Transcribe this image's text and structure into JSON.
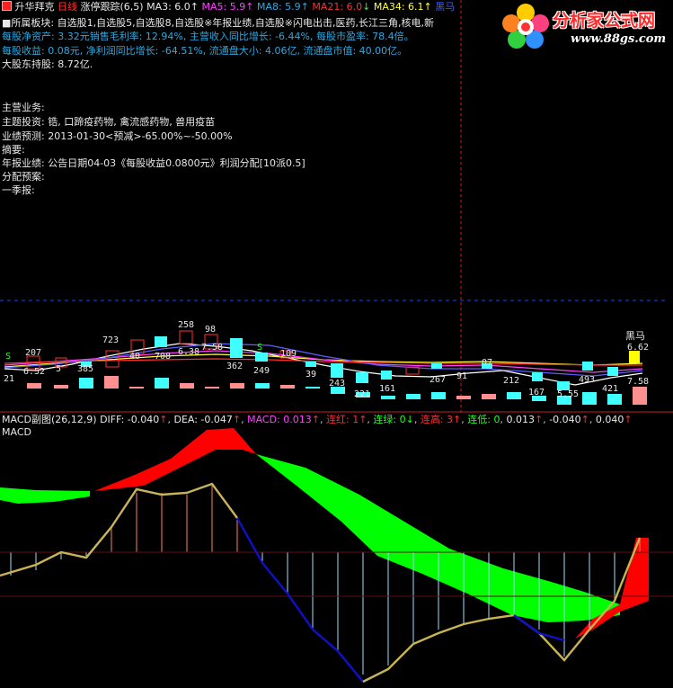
{
  "header": {
    "app_icon": "close-square-icon",
    "app_name": "升华拜克",
    "period": "日线",
    "indicator_name": "涨停跟踪",
    "indicator_params": "(6,5)",
    "ma": [
      {
        "label": "MA3: 6.0",
        "arrow": "↑"
      },
      {
        "label": "MA5: 5.9",
        "arrow": "↑"
      },
      {
        "label": "MA8: 5.9",
        "arrow": "↑"
      },
      {
        "label": "MA21: 6.0",
        "arrow": "↓"
      },
      {
        "label": "MA34: 6.1",
        "arrow": "↑"
      },
      {
        "label": "黑马",
        "arrow": ""
      }
    ]
  },
  "logo": {
    "text": "分析家公式网",
    "url": "www.88gs.com",
    "icon": "flower-logo-icon"
  },
  "info": {
    "sector_line": "■所属板块: 自选股1,自选股5,自选股8,自选股※年报业绩,自选股※闪电出击,医药,长江三角,核电,新",
    "line2": "每股净资产: 3.32元销售毛利率: 12.94%, 主营收入同比增长: -6.44%, 每股市盈率: 78.4倍。",
    "line3": "每股收益: 0.08元, 净利润同比增长: -64.51%, 流通盘大小: 4.06亿, 流通盘市值: 40.00亿。",
    "line4": "大股东持股: 8.72亿.",
    "main_business": "主营业务:",
    "theme": "主题投资: 锆, 口蹄疫药物, 禽流感药物, 兽用疫苗",
    "forecast": "业绩预测: 2013-01-30<预减>-65.00%~-50.00%",
    "summary": "摘要:",
    "annual": "年报业绩: 公告日期04-03《每股收益0.0800元》利润分配[10派0.5]",
    "dividend_plan": "分配预案:",
    "q1": "一季报:"
  },
  "price_panel": {
    "labels": [
      "207",
      "723",
      "258",
      "98",
      "S",
      "S",
      "109",
      "362",
      "249",
      "39",
      "243",
      "221",
      "161",
      "267",
      "91",
      "07",
      "212",
      "167",
      "493",
      "5.55",
      "421",
      "7.58",
      "21",
      "5",
      "6.52",
      "385",
      "40",
      "708",
      "6.38",
      "7.58",
      "6.62"
    ],
    "heima_label": "黑马"
  },
  "macd": {
    "title": "MACD副图",
    "params": "(26,12,9)",
    "diff": "DIFF: -0.040",
    "diff_arrow": "↑",
    "dea": "DEA: -0.047",
    "dea_arrow": "↑",
    "macd": "MACD: 0.013",
    "macd_arrow": "↑",
    "lianhong": "连红: 1",
    "lianhong_arrow": "↑",
    "lianlv": "连绿: 0",
    "lianlv_arrow": "↓",
    "liangao": "连高: 3",
    "liangao_arrow": "↑",
    "liandi": "连低: 0",
    "v1": "0.013",
    "v1_arrow": "↑",
    "v2": "-0.040",
    "v2_arrow": "↑",
    "v3": "0.040",
    "v3_arrow": "↑",
    "sub_label": "MACD"
  },
  "colors": {
    "background": "#000000",
    "up": "#ff3030",
    "down": "#40ffff",
    "green_fill": "#00ff00",
    "red_fill": "#ff0000",
    "dea_line": "#1010c8",
    "diff_line": "#c8b450"
  }
}
